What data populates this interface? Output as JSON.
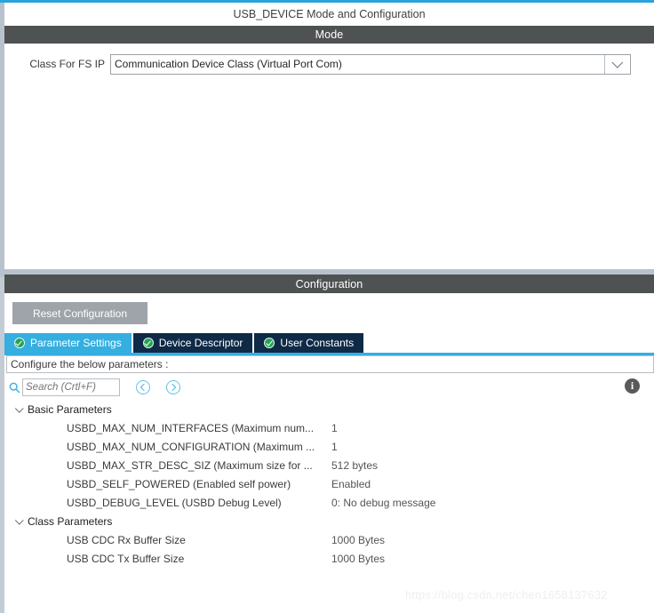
{
  "window": {
    "title": "USB_DEVICE Mode and Configuration"
  },
  "mode_panel": {
    "header": "Mode",
    "class_label": "Class For FS IP",
    "class_value": "Communication Device Class (Virtual Port Com)",
    "class_dropdown_icon": "chevron-down-icon"
  },
  "config_panel": {
    "header": "Configuration",
    "reset_button": "Reset Configuration",
    "tabs": [
      {
        "label": "Parameter Settings",
        "active": true,
        "icon": "green-check-icon"
      },
      {
        "label": "Device Descriptor",
        "active": false,
        "icon": "green-check-icon"
      },
      {
        "label": "User Constants",
        "active": false,
        "icon": "green-check-icon"
      }
    ],
    "configure_hint": "Configure the below parameters :",
    "search": {
      "placeholder": "Search (Crtl+F)",
      "value": "",
      "icon": "search-icon"
    },
    "nav_back_icon": "circle-left-arrow-icon",
    "nav_forward_icon": "circle-right-arrow-icon",
    "info_icon_label": "i",
    "groups": [
      {
        "label": "Basic Parameters",
        "expanded": true,
        "rows": [
          {
            "name": "USBD_MAX_NUM_INTERFACES (Maximum num...",
            "value": "1"
          },
          {
            "name": "USBD_MAX_NUM_CONFIGURATION (Maximum ...",
            "value": "1"
          },
          {
            "name": "USBD_MAX_STR_DESC_SIZ (Maximum size for ...",
            "value": "512 bytes"
          },
          {
            "name": "USBD_SELF_POWERED (Enabled self power)",
            "value": "Enabled"
          },
          {
            "name": "USBD_DEBUG_LEVEL (USBD Debug Level)",
            "value": "0: No debug message"
          }
        ]
      },
      {
        "label": "Class Parameters",
        "expanded": true,
        "rows": [
          {
            "name": "USB CDC Rx Buffer Size",
            "value": "1000 Bytes"
          },
          {
            "name": "USB CDC Tx Buffer Size",
            "value": "1000 Bytes"
          }
        ]
      }
    ]
  },
  "watermark": "https://blog.csdn.net/chen1658137632",
  "colors": {
    "accent_blue": "#29a3dc",
    "tab_active": "#35aee0",
    "tab_inactive": "#0e2a47",
    "header_bar": "#4f5253",
    "splitter": "#b7c2cc",
    "reset_button": "#9ea4a9",
    "check_green": "#23a455"
  }
}
